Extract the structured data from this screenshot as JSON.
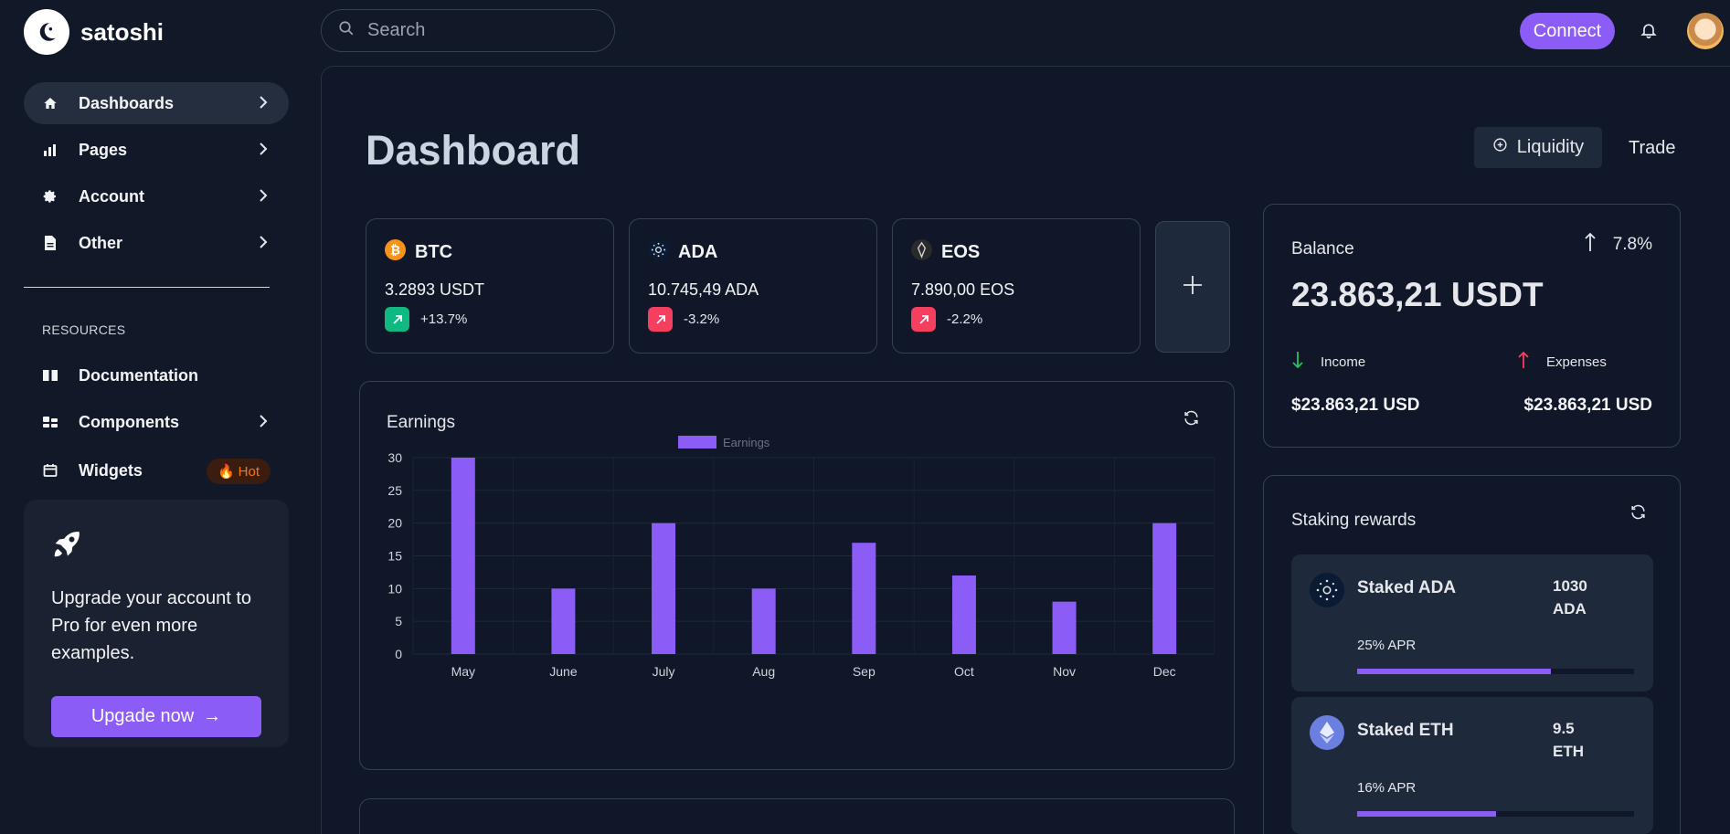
{
  "brand": {
    "name": "satoshi"
  },
  "search": {
    "placeholder": "Search"
  },
  "header": {
    "connect_label": "Connect"
  },
  "sidebar": {
    "items": [
      {
        "label": "Dashboards",
        "icon": "home-icon",
        "chevron": true,
        "active": true
      },
      {
        "label": "Pages",
        "icon": "bar-chart-icon",
        "chevron": true
      },
      {
        "label": "Account",
        "icon": "gear-icon",
        "chevron": true
      },
      {
        "label": "Other",
        "icon": "document-icon",
        "chevron": true
      }
    ],
    "resources_title": "RESOURCES",
    "resources": [
      {
        "label": "Documentation",
        "icon": "book-icon",
        "chevron": false
      },
      {
        "label": "Components",
        "icon": "components-icon",
        "chevron": true
      },
      {
        "label": "Widgets",
        "icon": "calendar-icon",
        "badge": "Hot"
      }
    ],
    "upgrade": {
      "text": "Upgrade your account to Pro for even more examples.",
      "button_label": "Upgade now",
      "arrow": "→"
    }
  },
  "main": {
    "title": "Dashboard",
    "actions": {
      "liquidity_label": "Liquidity",
      "trade_label": "Trade"
    },
    "coins": [
      {
        "symbol": "BTC",
        "price": "3.2893 USDT",
        "change": "+13.7%",
        "trend": "up",
        "color": "#22c55e"
      },
      {
        "symbol": "ADA",
        "price": "10.745,49 ADA",
        "change": "-3.2%",
        "trend": "down",
        "color": "#f43f5e"
      },
      {
        "symbol": "EOS",
        "price": "7.890,00 EOS",
        "change": "-2.2%",
        "trend": "down",
        "color": "#f43f5e"
      }
    ],
    "earnings": {
      "title": "Earnings"
    },
    "balance": {
      "label": "Balance",
      "change": "7.8%",
      "amount": "23.863,21 USDT",
      "income_label": "Income",
      "income_value": "$23.863,21 USD",
      "expenses_label": "Expenses",
      "expenses_value": "$23.863,21 USD"
    },
    "staking": {
      "title": "Staking rewards",
      "items": [
        {
          "name": "Staked ADA",
          "amount": "1030 ADA",
          "apr": "25% APR",
          "progress": 0.7
        },
        {
          "name": "Staked ETH",
          "amount": "9.5 ETH",
          "apr": "16% APR",
          "progress": 0.5
        }
      ]
    }
  },
  "colors": {
    "accent": "#8b5cf6",
    "positive": "#22c55e",
    "negative": "#f43f5e",
    "bg": "#111827"
  },
  "chart_data": {
    "type": "bar",
    "categories": [
      "May",
      "June",
      "July",
      "Aug",
      "Sep",
      "Oct",
      "Nov",
      "Dec"
    ],
    "series": [
      {
        "name": "Earnings",
        "values": [
          30,
          10,
          20,
          10,
          17,
          12,
          8,
          20
        ],
        "color": "#8b5cf6"
      }
    ],
    "ylim": [
      0,
      30
    ],
    "yticks": [
      0,
      5,
      10,
      15,
      20,
      25,
      30
    ],
    "legend": "top",
    "grid": true
  }
}
